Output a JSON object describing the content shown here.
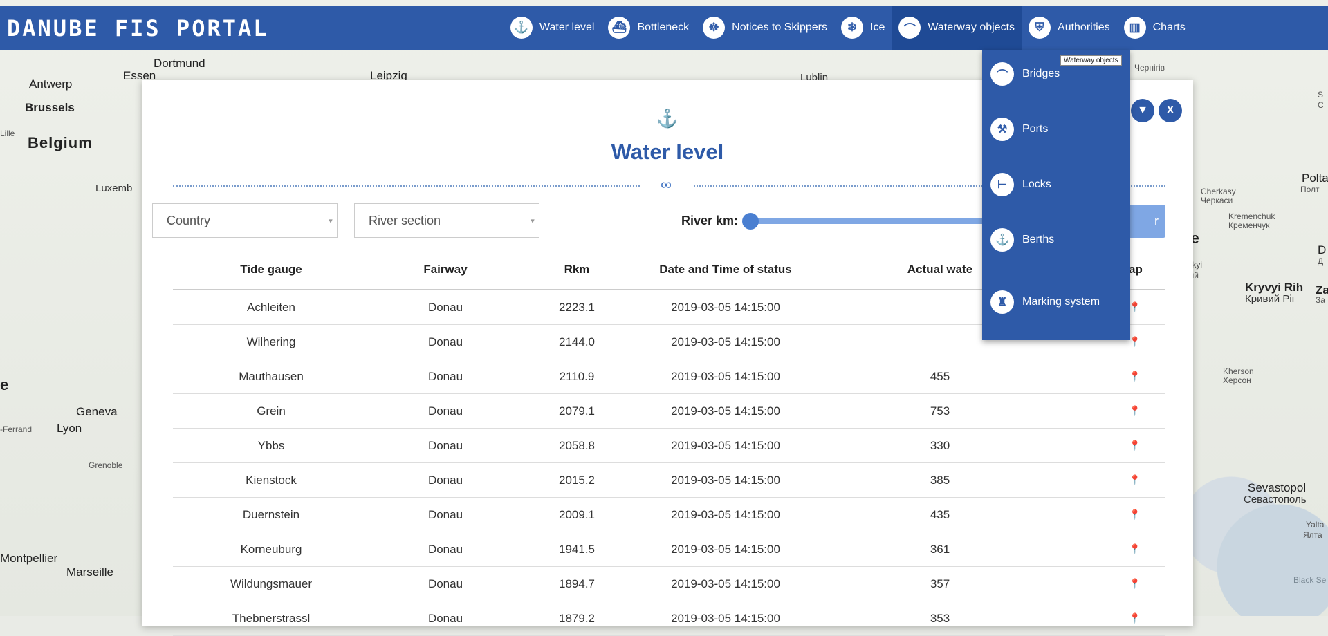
{
  "brand": "DANUBE FIS PORTAL",
  "nav": [
    {
      "label": "Water level",
      "icon": "water-level-icon"
    },
    {
      "label": "Bottleneck",
      "icon": "bottleneck-icon"
    },
    {
      "label": "Notices to Skippers",
      "icon": "ship-wheel-icon"
    },
    {
      "label": "Ice",
      "icon": "snowflake-icon"
    },
    {
      "label": "Waterway objects",
      "icon": "bridge-icon"
    },
    {
      "label": "Authorities",
      "icon": "authorities-icon"
    },
    {
      "label": "Charts",
      "icon": "book-icon"
    }
  ],
  "tooltip": "Waterway objects",
  "dropdown": [
    "Bridges",
    "Ports",
    "Locks",
    "Berths",
    "Marking system"
  ],
  "map_labels": {
    "dortmund": "Dortmund",
    "essen": "Essen",
    "leipzig": "Leipzig",
    "lublin": "Lublin",
    "antwerp": "Antwerp",
    "brussels": "Brussels",
    "lille": "Lille",
    "belgium": "Belgium",
    "luxemb": "Luxemb",
    "geneva": "Geneva",
    "lyon": "Lyon",
    "ferrand": "-Ferrand",
    "grenoble": "Grenoble",
    "montpellier": "Montpellier",
    "marseille": "Marseille",
    "chernihiv": "Чернігів",
    "cherkasy": "Cherkasy",
    "cherkasy_cyr": "Черкаси",
    "kremenchuk": "Kremenchuk",
    "kremenchuk_cyr": "Кременчук",
    "poltava": "Polta",
    "poltava_cyr": "Полт",
    "ukraine": "ine",
    "kryvyi": "Kryvyi Rih",
    "kryvyi_cyr": "Кривий Ріг",
    "zap": "Zap",
    "zap_cyr": "За",
    "kherson": "Kherson",
    "kherson_cyr": "Херсон",
    "sevastopol": "Sevastopol",
    "sevastopol_cyr": "Севастополь",
    "yalta": "Yalta",
    "yalta_cyr": "Ялта",
    "black_sea": "Black Se",
    "ytskyi": "ytskyi",
    "skyi_cyr": "ький",
    "e": "e",
    "s_top": "S",
    "c_top": "C",
    "d": "D",
    "d_cyr": "Д"
  },
  "modal": {
    "title": "Water level",
    "country_placeholder": "Country",
    "section_placeholder": "River section",
    "rkm_label": "River km:",
    "filter_btn_text": "r",
    "close_label": "X",
    "headers": [
      "Tide gauge",
      "Fairway",
      "Rkm",
      "Date and Time of status",
      "Actual wate",
      "ap"
    ],
    "rows": [
      [
        "Achleiten",
        "Donau",
        "2223.1",
        "2019-03-05 14:15:00",
        ""
      ],
      [
        "Wilhering",
        "Donau",
        "2144.0",
        "2019-03-05 14:15:00",
        ""
      ],
      [
        "Mauthausen",
        "Donau",
        "2110.9",
        "2019-03-05 14:15:00",
        "455"
      ],
      [
        "Grein",
        "Donau",
        "2079.1",
        "2019-03-05 14:15:00",
        "753"
      ],
      [
        "Ybbs",
        "Donau",
        "2058.8",
        "2019-03-05 14:15:00",
        "330"
      ],
      [
        "Kienstock",
        "Donau",
        "2015.2",
        "2019-03-05 14:15:00",
        "385"
      ],
      [
        "Duernstein",
        "Donau",
        "2009.1",
        "2019-03-05 14:15:00",
        "435"
      ],
      [
        "Korneuburg",
        "Donau",
        "1941.5",
        "2019-03-05 14:15:00",
        "361"
      ],
      [
        "Wildungsmauer",
        "Donau",
        "1894.7",
        "2019-03-05 14:15:00",
        "357"
      ],
      [
        "Thebnerstrassl",
        "Donau",
        "1879.2",
        "2019-03-05 14:15:00",
        "353"
      ]
    ]
  }
}
